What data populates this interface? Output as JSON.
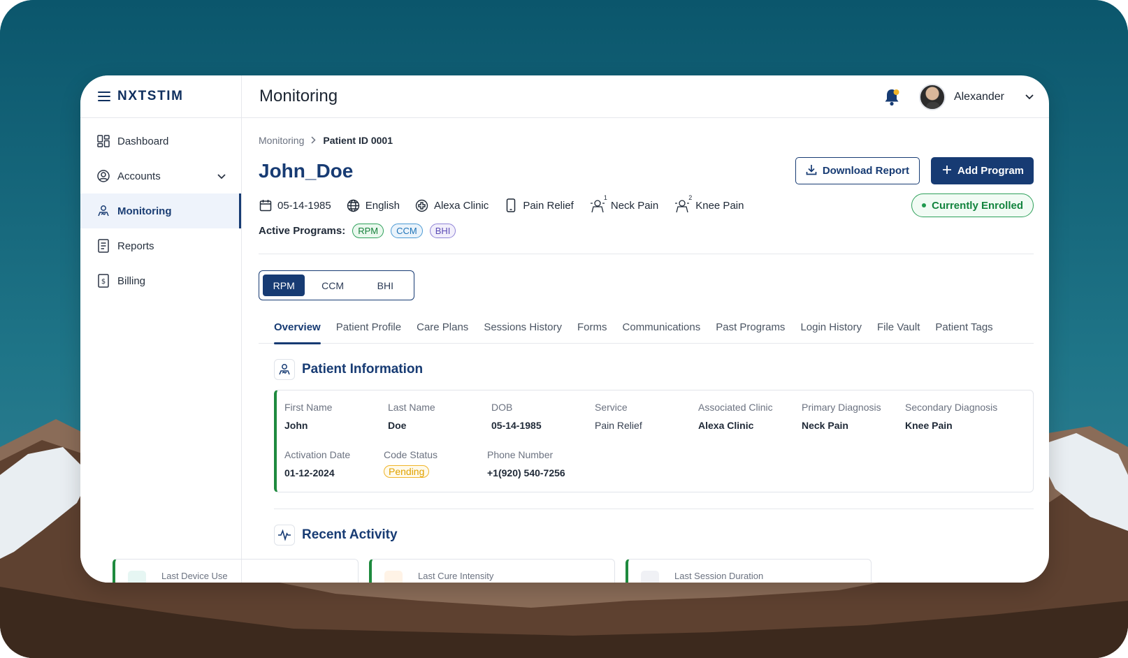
{
  "brand": {
    "name": "NXTSTIM"
  },
  "sidebar": {
    "items": [
      {
        "label": "Dashboard",
        "icon": "dashboard-icon"
      },
      {
        "label": "Accounts",
        "icon": "user-circle-icon",
        "has_chevron": true
      },
      {
        "label": "Monitoring",
        "icon": "monitoring-icon",
        "active": true
      },
      {
        "label": "Reports",
        "icon": "report-icon"
      },
      {
        "label": "Billing",
        "icon": "billing-icon"
      }
    ]
  },
  "header": {
    "title": "Monitoring",
    "user_name": "Alexander",
    "notification_icon": "bell-icon"
  },
  "breadcrumb": {
    "parent": "Monitoring",
    "current": "Patient ID 0001"
  },
  "patient": {
    "name": "John_Doe",
    "dob": "05-14-1985",
    "language": "English",
    "clinic": "Alexa Clinic",
    "service": "Pain Relief",
    "primary_condition": "Neck Pain",
    "primary_condition_rank": "1",
    "secondary_condition": "Knee Pain",
    "secondary_condition_rank": "2",
    "status": "Currently Enrolled"
  },
  "actions": {
    "download_label": "Download Report",
    "add_program_label": "Add Program"
  },
  "active_programs": {
    "label": "Active Programs:",
    "items": [
      "RPM",
      "CCM",
      "BHI"
    ]
  },
  "program_switch": {
    "options": [
      "RPM",
      "CCM",
      "BHI"
    ],
    "selected": "RPM"
  },
  "tabs": [
    {
      "label": "Overview",
      "active": true
    },
    {
      "label": "Patient Profile"
    },
    {
      "label": "Care Plans"
    },
    {
      "label": "Sessions History"
    },
    {
      "label": "Forms"
    },
    {
      "label": "Communications"
    },
    {
      "label": "Past Programs"
    },
    {
      "label": "Login History"
    },
    {
      "label": "File Vault"
    },
    {
      "label": "Patient Tags"
    }
  ],
  "patient_info": {
    "title": "Patient Information",
    "fields": {
      "first_name": {
        "label": "First Name",
        "value": "John"
      },
      "last_name": {
        "label": "Last Name",
        "value": "Doe"
      },
      "dob": {
        "label": "DOB",
        "value": "05-14-1985"
      },
      "service": {
        "label": "Service",
        "value": "Pain Relief"
      },
      "clinic": {
        "label": "Associated Clinic",
        "value": "Alexa Clinic"
      },
      "primary": {
        "label": "Primary Diagnosis",
        "value": "Neck Pain"
      },
      "secondary": {
        "label": "Secondary Diagnosis",
        "value": "Knee Pain"
      },
      "activation": {
        "label": "Activation Date",
        "value": "01-12-2024"
      },
      "code_status": {
        "label": "Code Status",
        "value": "Pending"
      },
      "phone": {
        "label": "Phone Number",
        "value": "+1(920) 540-7256"
      }
    }
  },
  "recent_activity": {
    "title": "Recent Activity",
    "cards": [
      {
        "label": "Last Device Use"
      },
      {
        "label": "Last Cure Intensity"
      },
      {
        "label": "Last Session Duration"
      }
    ]
  },
  "colors": {
    "brand": "#173b73",
    "success": "#1e8a3e",
    "warning": "#f0b429",
    "accent_ccm": "#4b9ad4",
    "accent_bhi": "#8f83d6"
  }
}
